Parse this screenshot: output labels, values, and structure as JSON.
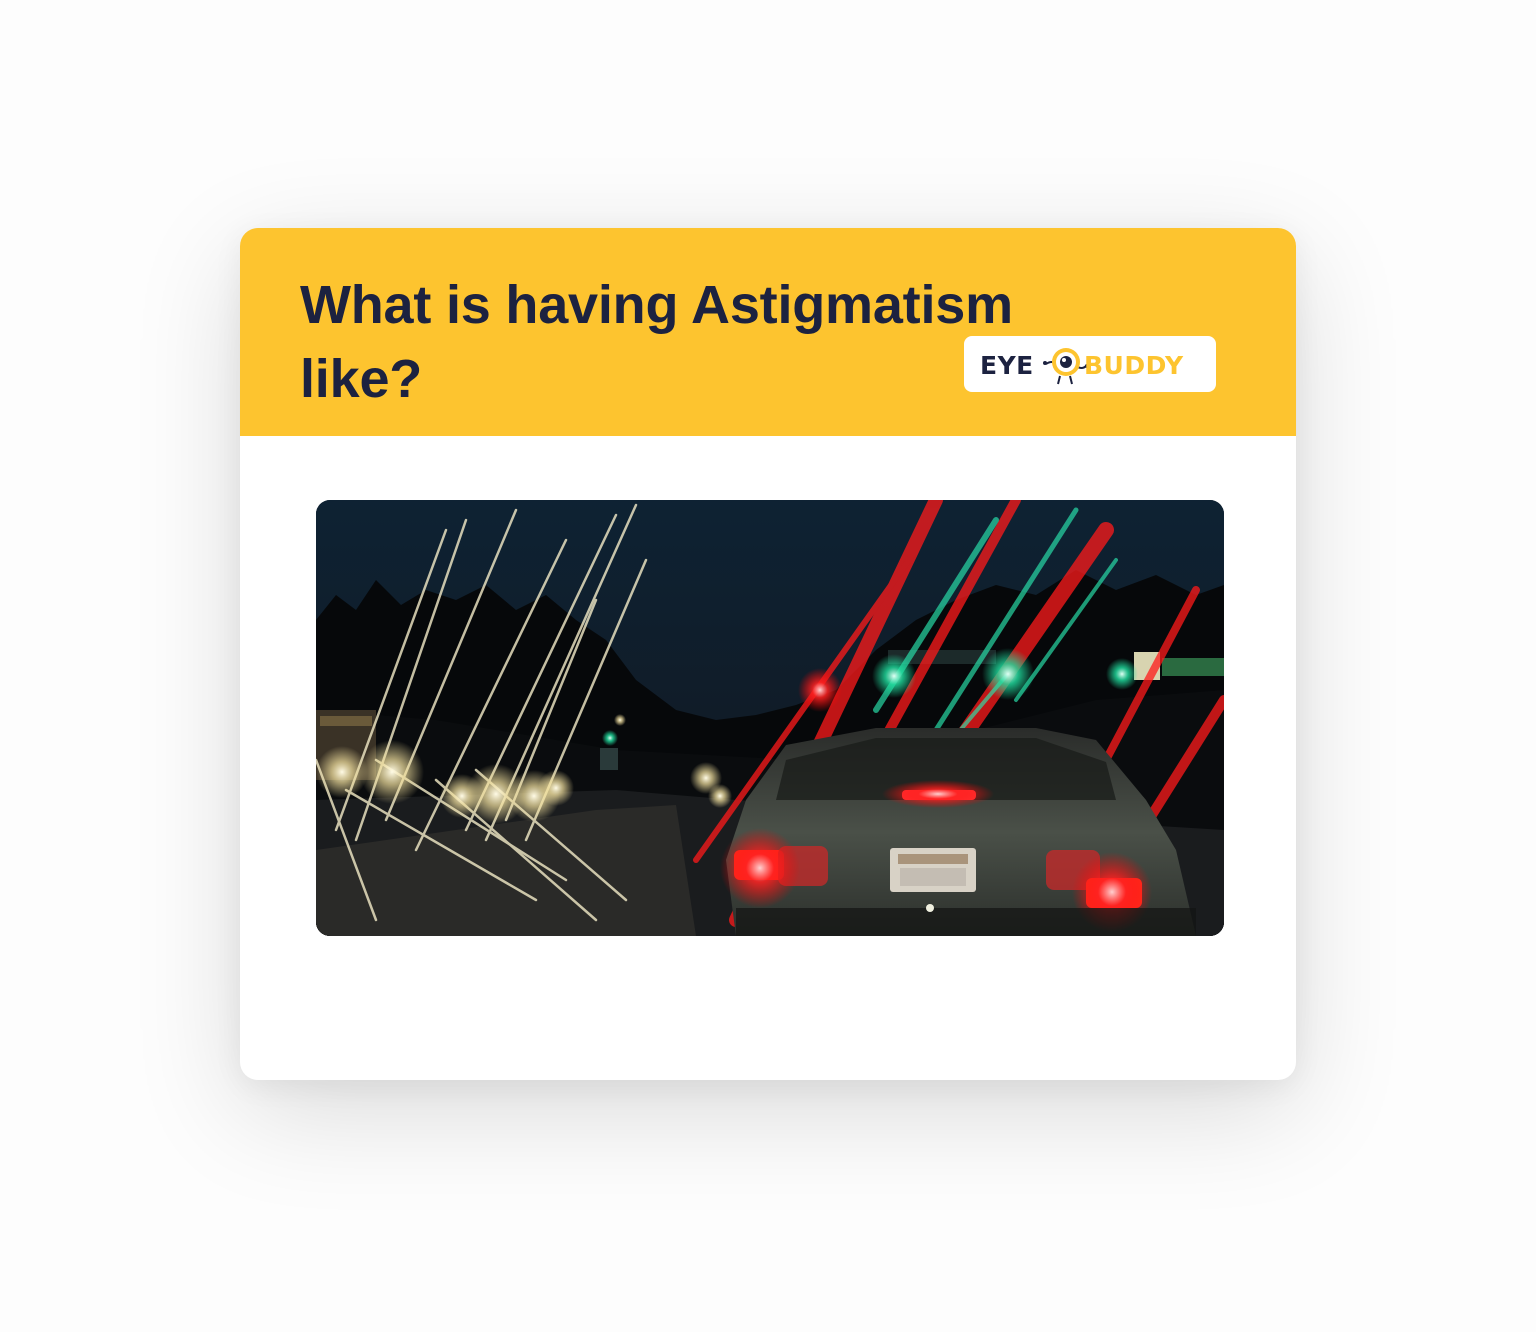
{
  "card": {
    "title": "What is having Astigmatism like?",
    "logo": {
      "word_left": "EYE",
      "word_right": "BUDDY",
      "mascot_icon": "eye-mascot-icon"
    },
    "photo_icon": "night-road-astigmatism-photo"
  },
  "colors": {
    "header_yellow": "#fdc42f",
    "title_navy": "#1c2240",
    "card_white": "#ffffff"
  }
}
